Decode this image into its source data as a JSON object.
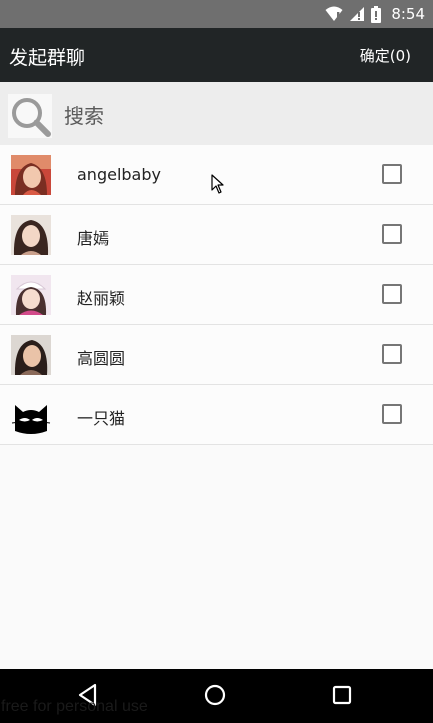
{
  "status_bar": {
    "time": "8:54"
  },
  "header": {
    "title": "发起群聊",
    "confirm_label": "确定(0)"
  },
  "search": {
    "placeholder": "搜索"
  },
  "contacts": [
    {
      "name": "angelbaby",
      "checked": false
    },
    {
      "name": "唐嫣",
      "checked": false
    },
    {
      "name": "赵丽颖",
      "checked": false
    },
    {
      "name": "高圆圆",
      "checked": false
    },
    {
      "name": "一只猫",
      "checked": false
    }
  ],
  "watermark": "free for personal use",
  "colors": {
    "status_bar": "#6f6f6f",
    "app_bar": "#212526",
    "search_bar": "#ededed",
    "nav_bar": "#000000"
  }
}
